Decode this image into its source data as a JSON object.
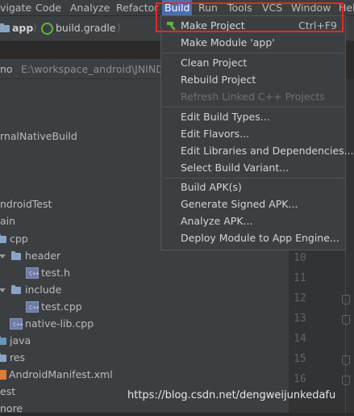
{
  "menubar": {
    "items": [
      {
        "label": "vigate"
      },
      {
        "label": "Code"
      },
      {
        "label": "Analyze"
      },
      {
        "label": "Refactor"
      },
      {
        "label": "Build"
      },
      {
        "label": "Run"
      },
      {
        "label": "Tools"
      },
      {
        "label": "VCS"
      },
      {
        "label": "Window"
      },
      {
        "label": "Hel"
      }
    ]
  },
  "navbar": {
    "crumb_module": "app",
    "crumb_file": "build.gradle"
  },
  "project_header": {
    "name": "no",
    "path": "E:\\workspace_android\\JNINDK"
  },
  "tree": {
    "rows": [
      {
        "label": "rnalNativeBuild"
      },
      {
        "label": "ndroidTest"
      },
      {
        "label": "ain"
      },
      {
        "label": "cpp"
      },
      {
        "label": "header"
      },
      {
        "label": "test.h"
      },
      {
        "label": "include"
      },
      {
        "label": "test.cpp"
      },
      {
        "label": "native-lib.cpp"
      },
      {
        "label": "java"
      },
      {
        "label": "res"
      },
      {
        "label": "AndroidManifest.xml"
      },
      {
        "label": "est"
      },
      {
        "label": "nore"
      }
    ]
  },
  "editor": {
    "line_numbers": [
      "10",
      "11",
      "12",
      "13",
      "14",
      "15",
      "16"
    ]
  },
  "build_menu": {
    "items": [
      {
        "label": "Make Project",
        "shortcut": "Ctrl+F9"
      },
      {
        "label": "Make Module 'app'"
      },
      {
        "label": "Clean Project"
      },
      {
        "label": "Rebuild Project"
      },
      {
        "label": "Refresh Linked C++ Projects"
      },
      {
        "label": "Edit Build Types..."
      },
      {
        "label": "Edit Flavors..."
      },
      {
        "label": "Edit Libraries and Dependencies..."
      },
      {
        "label": "Select Build Variant..."
      },
      {
        "label": "Build APK(s)"
      },
      {
        "label": "Generate Signed APK..."
      },
      {
        "label": "Analyze APK..."
      },
      {
        "label": "Deploy Module to App Engine..."
      }
    ]
  },
  "watermark": "https://blog.csdn.net/dengweijunkedafu",
  "colors": {
    "background": "#2b2b2b",
    "panel": "#3c3f41",
    "menu_active": "#4b6eaf",
    "highlight_box": "#e8262b",
    "hammer": "#62b543"
  }
}
